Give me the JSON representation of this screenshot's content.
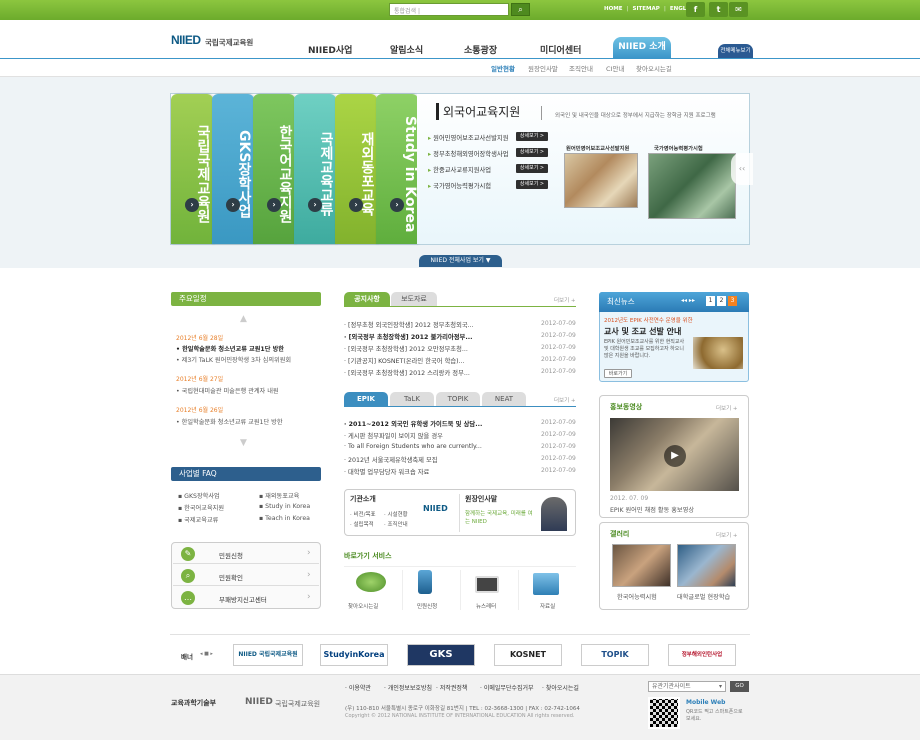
{
  "top": {
    "search_placeholder": "통합검색 |",
    "links": [
      "HOME",
      "SITEMAP",
      "ENGLISH"
    ],
    "sns": [
      "f",
      "t",
      "✉"
    ]
  },
  "header": {
    "logo_mark": "NIIED",
    "logo_text": "국립국제교육원",
    "gnb": [
      "NIIED사업",
      "알림소식",
      "소통광장",
      "미디어센터"
    ],
    "gnb_active": "NIIED 소개",
    "all_menu": "전체메뉴보기 ▼",
    "sub": [
      "일반현황",
      "원장인사말",
      "조직안내",
      "CI안내",
      "찾아오시는길"
    ]
  },
  "visual": {
    "tabs": [
      "국립국제교육원",
      "GKS장학사업",
      "한국어교육지원",
      "국제교육교류",
      "재외동포교육",
      "Study in Korea"
    ],
    "title": "외국어교육지원",
    "desc": "외국인 및 내국인을 대상으로 정부에서 지급하는 장학금 지원 프로그램",
    "links": [
      "원어민영어보조교사선발지원",
      "정부초청해외영어장학생사업",
      "한중교사교류지원사업",
      "국가영어능력평가시험"
    ],
    "btn": "상세보기 >",
    "thumb1": "원어민영어보조교사선발지원",
    "thumb2": "국가영어능력평가시험",
    "all_biz": "NIIED 전체사업 보기 ▼",
    "next": "next"
  },
  "schedule": {
    "title": "주요일정",
    "groups": [
      {
        "date": "2012년 6월 28일",
        "items": [
          "한일학술문화 청소년교류 교원1단 방한",
          "제3기 TaLK 원어민장학생 3차 심의위원회"
        ]
      },
      {
        "date": "2012년 6월 27일",
        "items": [
          "국립현대미술관 미술은행 관계자 내원"
        ]
      },
      {
        "date": "2012년 6월 26일",
        "items": [
          "한일학술문화 청소년교류 교원1단 방한"
        ]
      }
    ]
  },
  "faq": {
    "title": "사업별 FAQ",
    "items": [
      "GKS장학사업",
      "재외동포교육",
      "한국어교육지원",
      "Study in Korea",
      "국제교육교류",
      "Teach in Korea"
    ]
  },
  "quick": [
    "민원신청",
    "민원확인",
    "부패방지신고센터"
  ],
  "notice": {
    "tabs": [
      "공지사항",
      "보도자료"
    ],
    "more": "더보기 +",
    "rows": [
      {
        "t": "[정부초청 외국인장학생] 2012 정부초청외국...",
        "d": "2012-07-09"
      },
      {
        "t": "[외국정부 초청장학생] 2012 불가리아정부...",
        "d": "2012-07-09"
      },
      {
        "t": "[외국정부 초청장학생] 2012 오만정부초청...",
        "d": "2012-07-09"
      },
      {
        "t": "[기관공지] KOSNET(온라인 한국어 학습)...",
        "d": "2012-07-09"
      },
      {
        "t": "[외국정부 초청장학생] 2012 스리랑카 정부...",
        "d": "2012-07-09"
      }
    ]
  },
  "programs": {
    "tabs": [
      "EPIK",
      "TaLK",
      "TOPIK",
      "NEAT"
    ],
    "more": "더보기 +",
    "rows": [
      {
        "t": "2011~2012 외국인 유학생 가이드북 및 상담...",
        "d": "2012-07-09"
      },
      {
        "t": "게시판 첨부파일이 보이지 않을 경우",
        "d": "2012-07-09"
      },
      {
        "t": "To all Foreign Students who are currently...",
        "d": "2012-07-09"
      },
      {
        "t": "2012년 서울국제유학생축제 모집",
        "d": "2012-07-09"
      },
      {
        "t": "대학별 업무담당자 워크숍 자료",
        "d": "2012-07-09"
      }
    ]
  },
  "intro": {
    "title": "기관소개",
    "links": [
      "비전/목표",
      "시설현황",
      "설립목적",
      "조직안내"
    ],
    "greet_title": "원장인사말",
    "greet_text": "함께하는 국제교육, 미래를 여는 NIIED"
  },
  "shortcut": {
    "title": "바로가기 서비스",
    "items": [
      "찾아오시는길",
      "민원신청",
      "뉴스레터",
      "자료실"
    ]
  },
  "latest": {
    "title": "최신뉴스",
    "pages": [
      "1",
      "2",
      "3"
    ],
    "headline_small": "2012년도 EPIK 사전연수 운영을 위한",
    "headline": "교사 및 조교 선발 안내",
    "body": "EPIK 원어민보조교사를 위한 현직교사 및 대학원생 조교를 모집하고자 하오니 많은 지원을 바랍니다.",
    "more_btn": "바로가기"
  },
  "video": {
    "title": "홍보동영상",
    "more": "더보기 +",
    "date": "2012. 07. 09",
    "caption": "EPIK 원어민 채점 활동 홍보영상"
  },
  "gallery": {
    "title": "갤러리",
    "more": "더보기 +",
    "items": [
      "한국어능력시험",
      "대학글로벌 현장학습"
    ]
  },
  "banners": {
    "label": "배너",
    "items": [
      "NIIED 국립국제교육원",
      "StudyinKorea",
      "GKS",
      "KOSNET",
      "TOPIK",
      "정부해외인턴사업"
    ]
  },
  "footer": {
    "links": [
      "이용약관",
      "개인정보보호방침",
      "저작권정책",
      "이메일무단수집거부",
      "찾아오시는길"
    ],
    "address": "(우) 110-810 서울특별시 종로구 이화장길 81번지 | TEL : 02-3668-1300 | FAX : 02-742-1064",
    "copyright": "Copyright © 2012 NATIONAL INSTITUTE OF INTERNATIONAL EDUCATION All rights reserved.",
    "ministry": "교육과학기술부",
    "select": "유관기관사이트",
    "go": "GO",
    "mobile_title": "Mobile Web",
    "mobile_text": "QR코드 찍고 스마트폰으로 보세요."
  }
}
